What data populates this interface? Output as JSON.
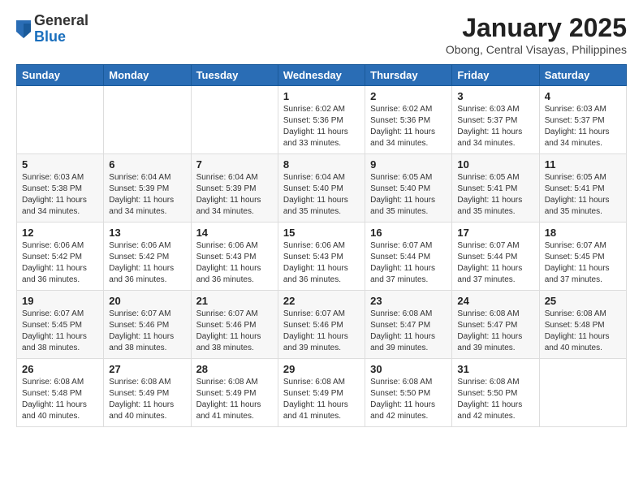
{
  "header": {
    "logo": {
      "general": "General",
      "blue": "Blue"
    },
    "title": "January 2025",
    "location": "Obong, Central Visayas, Philippines"
  },
  "weekdays": [
    "Sunday",
    "Monday",
    "Tuesday",
    "Wednesday",
    "Thursday",
    "Friday",
    "Saturday"
  ],
  "weeks": [
    [
      {
        "day": "",
        "sunrise": "",
        "sunset": "",
        "daylight": ""
      },
      {
        "day": "",
        "sunrise": "",
        "sunset": "",
        "daylight": ""
      },
      {
        "day": "",
        "sunrise": "",
        "sunset": "",
        "daylight": ""
      },
      {
        "day": "1",
        "sunrise": "6:02 AM",
        "sunset": "5:36 PM",
        "daylight": "11 hours and 33 minutes."
      },
      {
        "day": "2",
        "sunrise": "6:02 AM",
        "sunset": "5:36 PM",
        "daylight": "11 hours and 34 minutes."
      },
      {
        "day": "3",
        "sunrise": "6:03 AM",
        "sunset": "5:37 PM",
        "daylight": "11 hours and 34 minutes."
      },
      {
        "day": "4",
        "sunrise": "6:03 AM",
        "sunset": "5:37 PM",
        "daylight": "11 hours and 34 minutes."
      }
    ],
    [
      {
        "day": "5",
        "sunrise": "6:03 AM",
        "sunset": "5:38 PM",
        "daylight": "11 hours and 34 minutes."
      },
      {
        "day": "6",
        "sunrise": "6:04 AM",
        "sunset": "5:39 PM",
        "daylight": "11 hours and 34 minutes."
      },
      {
        "day": "7",
        "sunrise": "6:04 AM",
        "sunset": "5:39 PM",
        "daylight": "11 hours and 34 minutes."
      },
      {
        "day": "8",
        "sunrise": "6:04 AM",
        "sunset": "5:40 PM",
        "daylight": "11 hours and 35 minutes."
      },
      {
        "day": "9",
        "sunrise": "6:05 AM",
        "sunset": "5:40 PM",
        "daylight": "11 hours and 35 minutes."
      },
      {
        "day": "10",
        "sunrise": "6:05 AM",
        "sunset": "5:41 PM",
        "daylight": "11 hours and 35 minutes."
      },
      {
        "day": "11",
        "sunrise": "6:05 AM",
        "sunset": "5:41 PM",
        "daylight": "11 hours and 35 minutes."
      }
    ],
    [
      {
        "day": "12",
        "sunrise": "6:06 AM",
        "sunset": "5:42 PM",
        "daylight": "11 hours and 36 minutes."
      },
      {
        "day": "13",
        "sunrise": "6:06 AM",
        "sunset": "5:42 PM",
        "daylight": "11 hours and 36 minutes."
      },
      {
        "day": "14",
        "sunrise": "6:06 AM",
        "sunset": "5:43 PM",
        "daylight": "11 hours and 36 minutes."
      },
      {
        "day": "15",
        "sunrise": "6:06 AM",
        "sunset": "5:43 PM",
        "daylight": "11 hours and 36 minutes."
      },
      {
        "day": "16",
        "sunrise": "6:07 AM",
        "sunset": "5:44 PM",
        "daylight": "11 hours and 37 minutes."
      },
      {
        "day": "17",
        "sunrise": "6:07 AM",
        "sunset": "5:44 PM",
        "daylight": "11 hours and 37 minutes."
      },
      {
        "day": "18",
        "sunrise": "6:07 AM",
        "sunset": "5:45 PM",
        "daylight": "11 hours and 37 minutes."
      }
    ],
    [
      {
        "day": "19",
        "sunrise": "6:07 AM",
        "sunset": "5:45 PM",
        "daylight": "11 hours and 38 minutes."
      },
      {
        "day": "20",
        "sunrise": "6:07 AM",
        "sunset": "5:46 PM",
        "daylight": "11 hours and 38 minutes."
      },
      {
        "day": "21",
        "sunrise": "6:07 AM",
        "sunset": "5:46 PM",
        "daylight": "11 hours and 38 minutes."
      },
      {
        "day": "22",
        "sunrise": "6:07 AM",
        "sunset": "5:46 PM",
        "daylight": "11 hours and 39 minutes."
      },
      {
        "day": "23",
        "sunrise": "6:08 AM",
        "sunset": "5:47 PM",
        "daylight": "11 hours and 39 minutes."
      },
      {
        "day": "24",
        "sunrise": "6:08 AM",
        "sunset": "5:47 PM",
        "daylight": "11 hours and 39 minutes."
      },
      {
        "day": "25",
        "sunrise": "6:08 AM",
        "sunset": "5:48 PM",
        "daylight": "11 hours and 40 minutes."
      }
    ],
    [
      {
        "day": "26",
        "sunrise": "6:08 AM",
        "sunset": "5:48 PM",
        "daylight": "11 hours and 40 minutes."
      },
      {
        "day": "27",
        "sunrise": "6:08 AM",
        "sunset": "5:49 PM",
        "daylight": "11 hours and 40 minutes."
      },
      {
        "day": "28",
        "sunrise": "6:08 AM",
        "sunset": "5:49 PM",
        "daylight": "11 hours and 41 minutes."
      },
      {
        "day": "29",
        "sunrise": "6:08 AM",
        "sunset": "5:49 PM",
        "daylight": "11 hours and 41 minutes."
      },
      {
        "day": "30",
        "sunrise": "6:08 AM",
        "sunset": "5:50 PM",
        "daylight": "11 hours and 42 minutes."
      },
      {
        "day": "31",
        "sunrise": "6:08 AM",
        "sunset": "5:50 PM",
        "daylight": "11 hours and 42 minutes."
      },
      {
        "day": "",
        "sunrise": "",
        "sunset": "",
        "daylight": ""
      }
    ]
  ]
}
